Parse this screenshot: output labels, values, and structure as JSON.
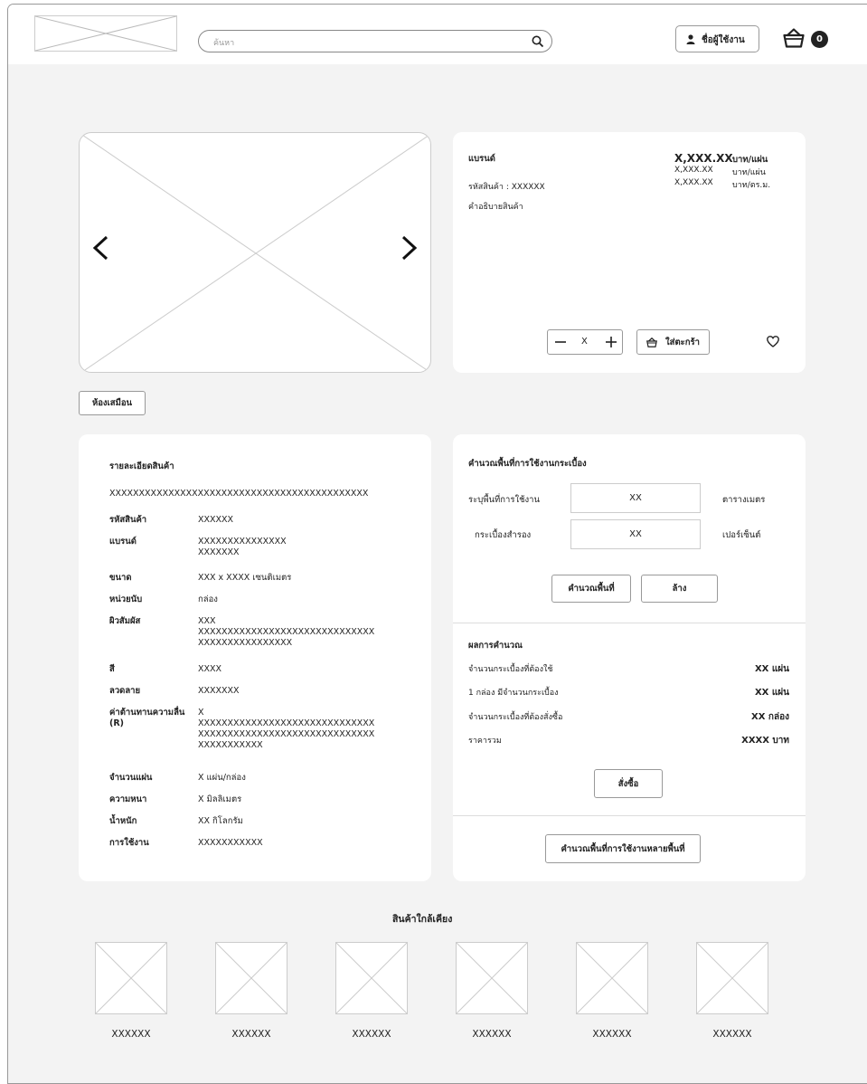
{
  "header": {
    "search_placeholder": "ค้นหา",
    "user_label": "ชื่อผู้ใช้งาน",
    "cart_count": "0"
  },
  "product": {
    "brand": "แบรนด์",
    "code": "รหัสสินค้า : XXXXXX",
    "description": "คำอธิบายสินค้า",
    "prices": [
      {
        "value": "X,XXX.XX",
        "unit": "บาท/แผ่น"
      },
      {
        "value": "X,XXX.XX",
        "unit": "บาท/แผ่น"
      },
      {
        "value": "X,XXX.XX",
        "unit": "บาท/ตร.ม."
      }
    ],
    "quantity": "X",
    "add_to_cart": "ใส่ตะกร้า"
  },
  "room_button": "ห้องเสมือน",
  "details": {
    "title": "รายละเอียดสินค้า",
    "summary": "XXXXXXXXXXXXXXXXXXXXXXXXXXXXXXXXXXXXXXXXXXXX",
    "specs": [
      {
        "label": "รหัสสินค้า",
        "value": "XXXXXX"
      },
      {
        "label": "แบรนด์",
        "value": "XXXXXXXXXXXXXXX\nXXXXXXX"
      },
      {
        "label": "ขนาด",
        "value": "XXX x XXXX  เซนติเมตร"
      },
      {
        "label": "หน่วยนับ",
        "value": "กล่อง"
      },
      {
        "label": "ผิวสัมผัส",
        "value": "XXX\nXXXXXXXXXXXXXXXXXXXXXXXXXXXXXX\nXXXXXXXXXXXXXXXX"
      },
      {
        "label": "สี",
        "value": "XXXX"
      },
      {
        "label": "ลวดลาย",
        "value": "XXXXXXX"
      },
      {
        "label": "ค่าต้านทานความลื่น\n(R)",
        "value": "X\nXXXXXXXXXXXXXXXXXXXXXXXXXXXXXX\nXXXXXXXXXXXXXXXXXXXXXXXXXXXXXX\nXXXXXXXXXXX"
      },
      {
        "label": "จำนวนแผ่น",
        "value": "X  แผ่น/กล่อง"
      },
      {
        "label": "ความหนา",
        "value": "X  มิลลิเมตร"
      },
      {
        "label": "น้ำหนัก",
        "value": "XX  กิโลกรัม"
      },
      {
        "label": "การใช้งาน",
        "value": "XXXXXXXXXXX"
      }
    ]
  },
  "calculator": {
    "title": "คำนวณพื้นที่การใช้งานกระเบื้อง",
    "area_label": "ระบุพื้นที่การใช้งาน",
    "area_value": "XX",
    "area_unit": "ตารางเมตร",
    "spare_label": "กระเบื้องสำรอง",
    "spare_value": "XX",
    "spare_unit": "เปอร์เซ็นต์",
    "calc_button": "คำนวณพื้นที่",
    "clear_button": "ล้าง",
    "result_title": "ผลการคำนวณ",
    "results": [
      {
        "label": "จำนวนกระเบื้องที่ต้องใช้",
        "value": "XX  แผ่น"
      },
      {
        "label": "1 กล่อง มีจำนวนกระเบื้อง",
        "value": "XX  แผ่น"
      },
      {
        "label": "จำนวนกระเบื้องที่ต้องสั่งซื้อ",
        "value": "XX  กล่อง"
      },
      {
        "label": "ราคารวม",
        "value": "XXXX  บาท"
      }
    ],
    "order_button": "สั่งซื้อ",
    "multi_area_button": "คำนวณพื้นที่การใช้งานหลายพื้นที่"
  },
  "similar": {
    "title": "สินค้าใกล้เคียง",
    "items": [
      {
        "name": "XXXXXX"
      },
      {
        "name": "XXXXXX"
      },
      {
        "name": "XXXXXX"
      },
      {
        "name": "XXXXXX"
      },
      {
        "name": "XXXXXX"
      },
      {
        "name": "XXXXXX"
      }
    ]
  }
}
